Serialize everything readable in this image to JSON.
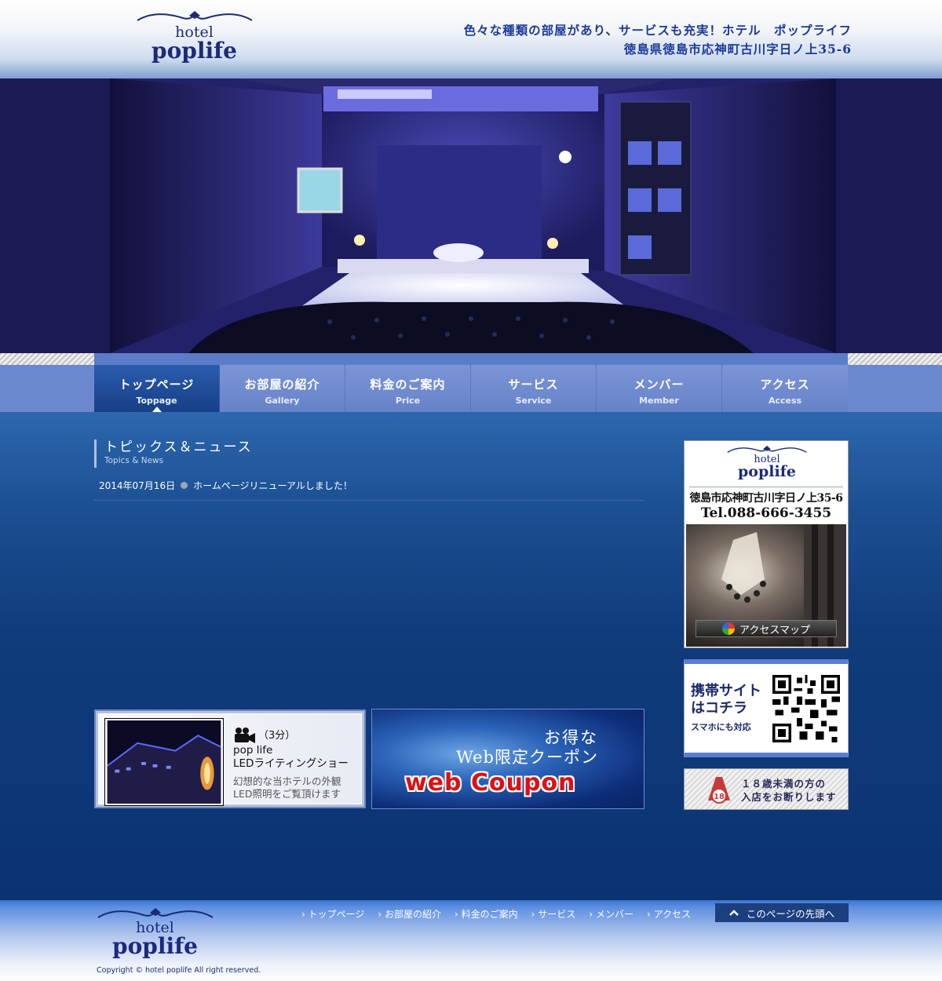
{
  "header": {
    "logo_top": "hotel",
    "logo_bottom": "poplife",
    "tagline": "色々な種類の部屋があり、サービスも充実！ホテル　ポップライフ",
    "address": "徳島県徳島市応神町古川字日ノ上35-6"
  },
  "nav": [
    {
      "jp": "トップページ",
      "en": "Toppage",
      "active": true
    },
    {
      "jp": "お部屋の紹介",
      "en": "Gallery"
    },
    {
      "jp": "料金のご案内",
      "en": "Price"
    },
    {
      "jp": "サービス",
      "en": "Service"
    },
    {
      "jp": "メンバー",
      "en": "Member"
    },
    {
      "jp": "アクセス",
      "en": "Access"
    }
  ],
  "topics": {
    "title_jp": "トピックス＆ニュース",
    "title_en": "Topics & News",
    "items": [
      {
        "date": "2014年07月16日",
        "text": "ホームページリニューアルしました！"
      }
    ]
  },
  "banners": {
    "video": {
      "duration": "（3分）",
      "title1": "pop life",
      "title2": "LEDライティングショー",
      "sub1": "幻想的な当ホテルの外観",
      "sub2": "LED照明をご覧頂けます"
    },
    "coupon": {
      "line1": "お得な",
      "line2": "Web限定クーポン",
      "line3": "web Coupon"
    }
  },
  "sidebar": {
    "info": {
      "logo_top": "hotel",
      "logo_bottom": "poplife",
      "address": "徳島市応神町古川字日ノ上35-6",
      "tel": "Tel.088-666-3455",
      "map_label": "アクセスマップ"
    },
    "mobile": {
      "line1": "携帯サイト",
      "line2": "はコチラ",
      "note": "スマホにも対応"
    },
    "age": {
      "badge": "18",
      "line1": "１８歳未満の方の",
      "line2": "入店をお断りします"
    }
  },
  "footer": {
    "logo_top": "hotel",
    "logo_bottom": "poplife",
    "links": [
      "トップページ",
      "お部屋の紹介",
      "料金のご案内",
      "サービス",
      "メンバー",
      "アクセス"
    ],
    "totop": "このページの先頭へ",
    "copyright": "Copyright © hotel poplife All right reserved."
  },
  "colors": {
    "navy": "#1b2a7a",
    "nav_bg": "#6b88cf",
    "nav_active": "#163f86",
    "main_bg": "#103c7c"
  }
}
